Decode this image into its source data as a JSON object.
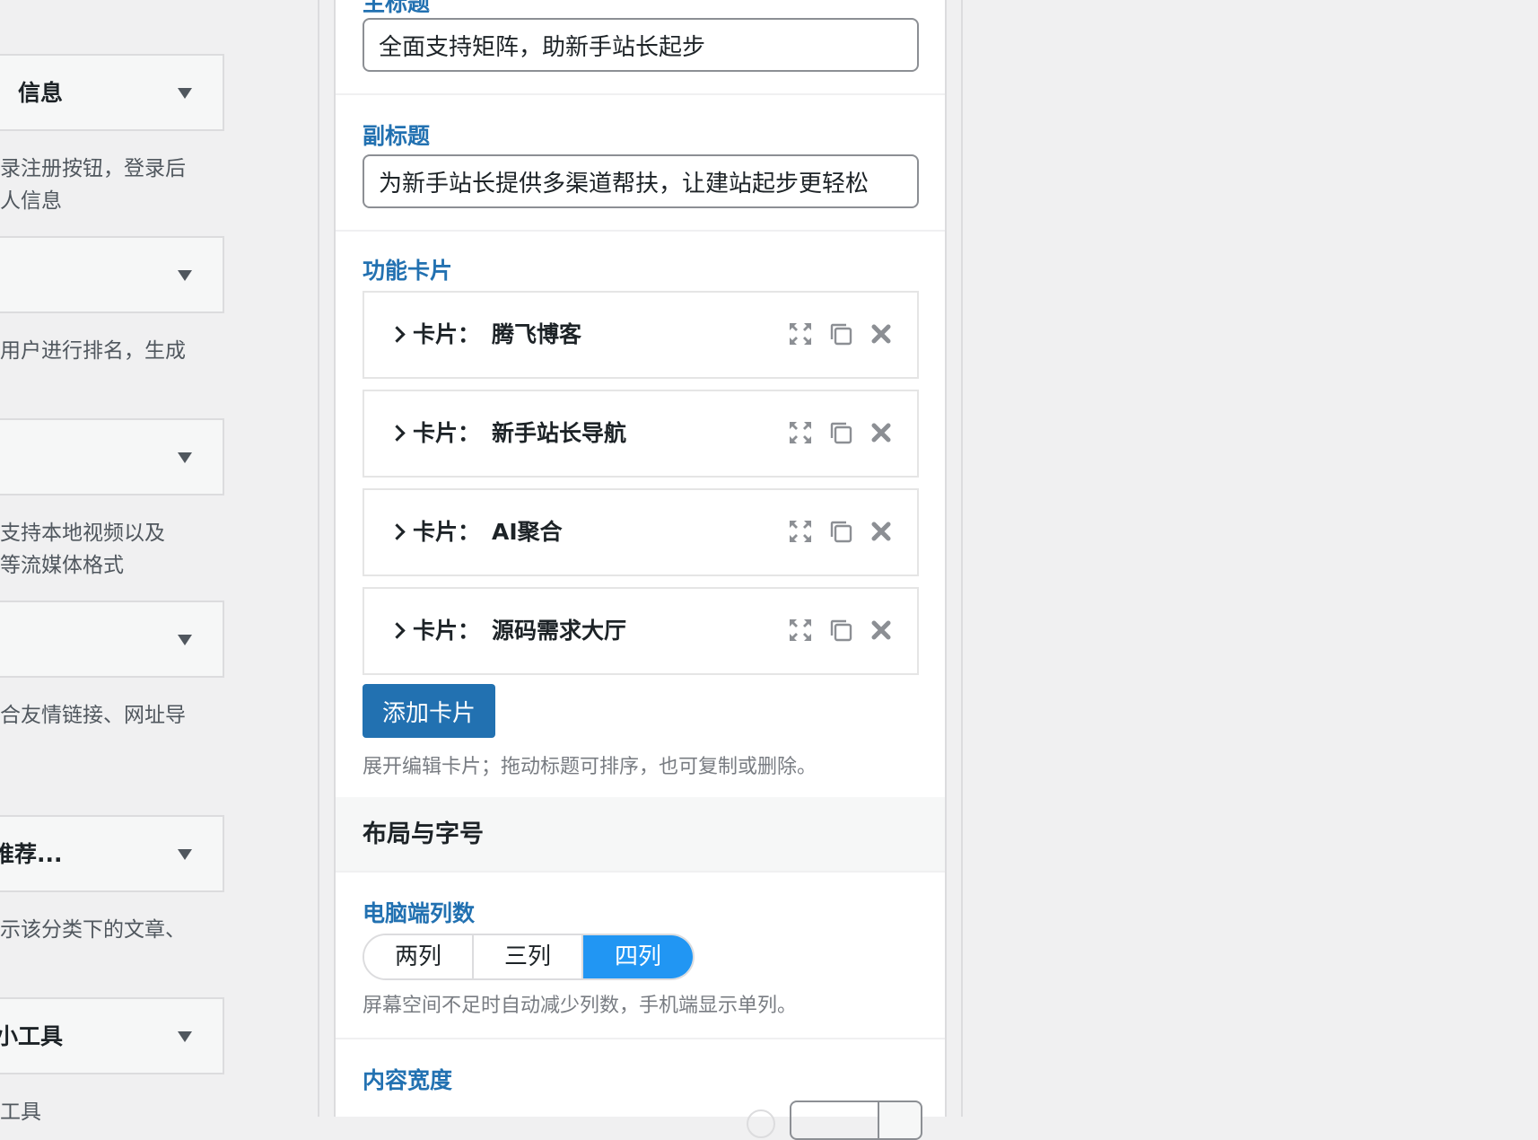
{
  "sidebar_widgets": [
    {
      "title": "信息",
      "desc": "录注册按钮，登录后\n人信息"
    },
    {
      "title": "",
      "desc": "用户进行排名，生成"
    },
    {
      "title": "",
      "desc": "支持本地视频以及\n等流媒体格式"
    },
    {
      "title": "",
      "desc": "合友情链接、网址导"
    },
    {
      "title": "榜单推荐...",
      "desc": "示该分类下的文章、"
    },
    {
      "title": "小工具",
      "desc": "工具"
    }
  ],
  "panel": {
    "main_title": {
      "label": "主标题",
      "value": "全面支持矩阵，助新手站长起步"
    },
    "subtitle": {
      "label": "副标题",
      "value": "为新手站长提供多渠道帮扶，让建站起步更轻松"
    },
    "cards": {
      "label": "功能卡片",
      "prefix": "卡片：",
      "items": [
        {
          "title": "腾飞博客"
        },
        {
          "title": "新手站长导航"
        },
        {
          "title": "AI聚合"
        },
        {
          "title": "源码需求大厅"
        }
      ],
      "add_label": "添加卡片",
      "hint": "展开编辑卡片；拖动标题可排序，也可复制或删除。"
    },
    "layout": {
      "heading": "布局与字号",
      "columns_label": "电脑端列数",
      "column_options": [
        "两列",
        "三列",
        "四列"
      ],
      "selected_option": "四列",
      "columns_hint": "屏幕空间不足时自动减少列数，手机端显示单列。",
      "content_width_label": "内容宽度"
    }
  },
  "colors": {
    "accent": "#2271b1",
    "segment_active": "#2196f3",
    "label_blue": "#2271b1"
  },
  "icons": {
    "expand": "expand-icon",
    "copy": "copy-icon",
    "delete": "delete-icon",
    "chevron": "chevron-right-icon",
    "dropdown": "dropdown-arrow-icon"
  }
}
